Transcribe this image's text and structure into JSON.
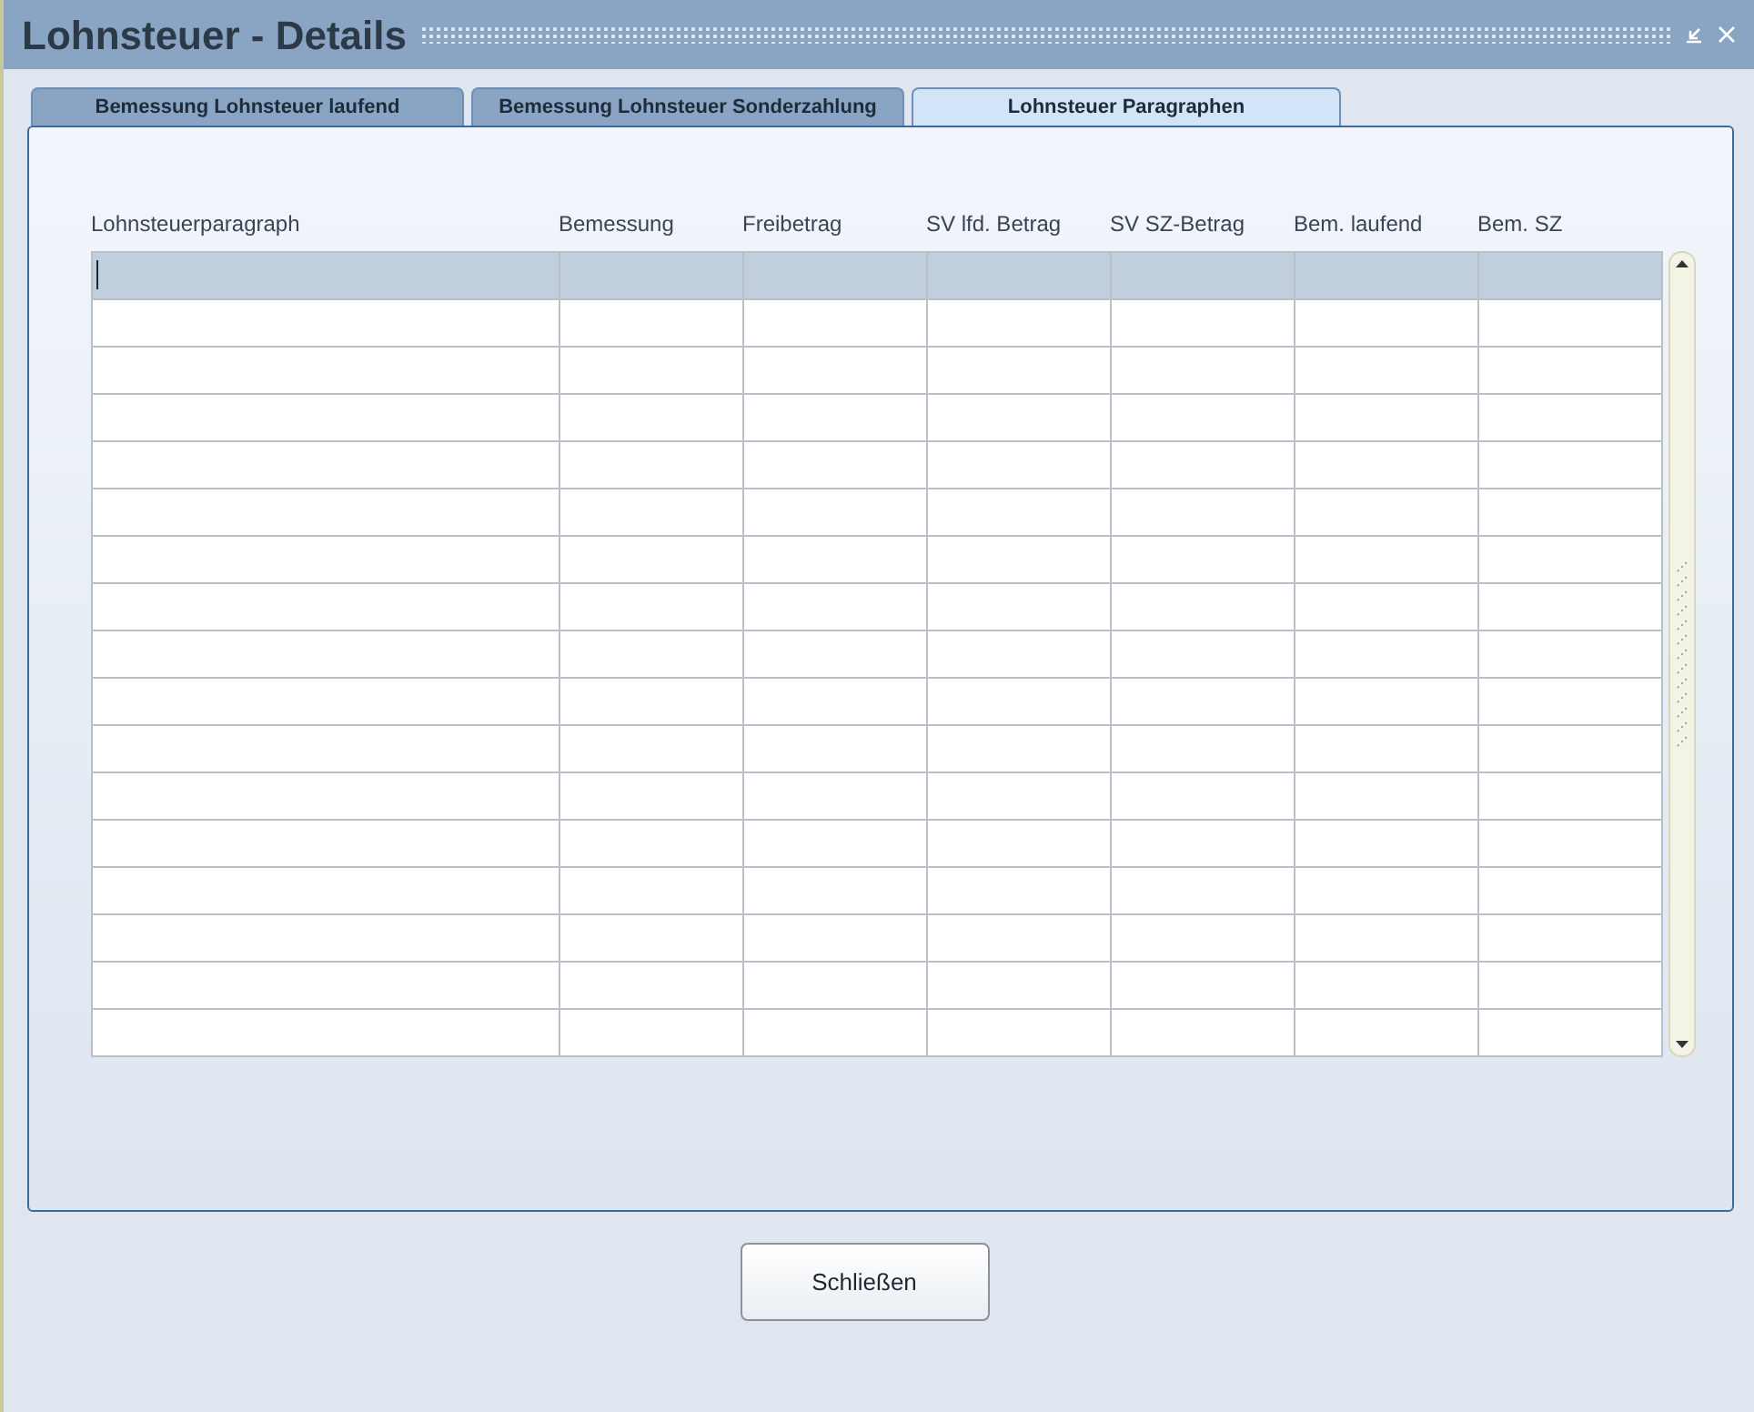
{
  "window": {
    "title": "Lohnsteuer - Details"
  },
  "tabs": [
    {
      "label": "Bemessung Lohnsteuer laufend",
      "selected": false
    },
    {
      "label": "Bemessung Lohnsteuer Sonderzahlung",
      "selected": false
    },
    {
      "label": "Lohnsteuer Paragraphen",
      "selected": true
    }
  ],
  "table": {
    "columns": [
      "Lohnsteuerparagraph",
      "Bemessung",
      "Freibetrag",
      "SV lfd. Betrag",
      "SV SZ-Betrag",
      "Bem. laufend",
      "Bem. SZ"
    ],
    "rows": [
      {
        "selected": true
      },
      {
        "selected": false
      },
      {
        "selected": false
      },
      {
        "selected": false
      },
      {
        "selected": false
      },
      {
        "selected": false
      },
      {
        "selected": false
      },
      {
        "selected": false
      },
      {
        "selected": false
      },
      {
        "selected": false
      },
      {
        "selected": false
      },
      {
        "selected": false
      },
      {
        "selected": false
      },
      {
        "selected": false
      },
      {
        "selected": false
      },
      {
        "selected": false
      },
      {
        "selected": false
      }
    ]
  },
  "buttons": [
    "Schließen"
  ]
}
